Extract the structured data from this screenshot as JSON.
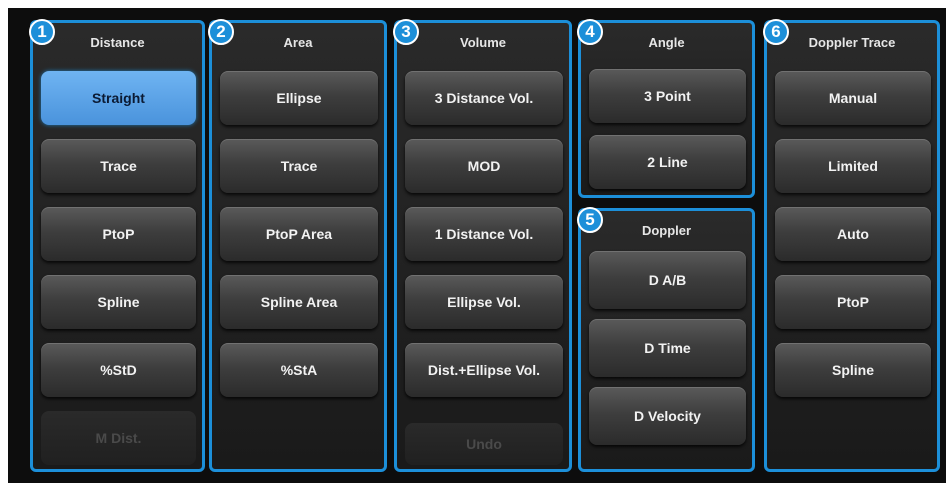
{
  "panels": [
    {
      "number": "1",
      "title": "Distance",
      "buttons": [
        {
          "label": "Straight",
          "state": "selected"
        },
        {
          "label": "Trace",
          "state": "normal"
        },
        {
          "label": "PtoP",
          "state": "normal"
        },
        {
          "label": "Spline",
          "state": "normal"
        },
        {
          "label": "%StD",
          "state": "normal"
        },
        {
          "label": "M Dist.",
          "state": "disabled"
        }
      ]
    },
    {
      "number": "2",
      "title": "Area",
      "buttons": [
        {
          "label": "Ellipse",
          "state": "normal"
        },
        {
          "label": "Trace",
          "state": "normal"
        },
        {
          "label": "PtoP Area",
          "state": "normal"
        },
        {
          "label": "Spline Area",
          "state": "normal"
        },
        {
          "label": "%StA",
          "state": "normal"
        }
      ]
    },
    {
      "number": "3",
      "title": "Volume",
      "buttons": [
        {
          "label": "3 Distance Vol.",
          "state": "normal"
        },
        {
          "label": "MOD",
          "state": "normal"
        },
        {
          "label": "1 Distance Vol.",
          "state": "normal"
        },
        {
          "label": "Ellipse Vol.",
          "state": "normal"
        },
        {
          "label": "Dist.+Ellipse Vol.",
          "state": "normal"
        },
        {
          "label": "Undo",
          "state": "disabled"
        }
      ]
    },
    {
      "number": "4",
      "title": "Angle",
      "buttons": [
        {
          "label": "3 Point",
          "state": "normal"
        },
        {
          "label": "2 Line",
          "state": "normal"
        }
      ]
    },
    {
      "number": "5",
      "title": "Doppler",
      "buttons": [
        {
          "label": "D A/B",
          "state": "normal"
        },
        {
          "label": "D Time",
          "state": "normal"
        },
        {
          "label": "D Velocity",
          "state": "normal"
        }
      ]
    },
    {
      "number": "6",
      "title": "Doppler Trace",
      "buttons": [
        {
          "label": "Manual",
          "state": "normal"
        },
        {
          "label": "Limited",
          "state": "normal"
        },
        {
          "label": "Auto",
          "state": "normal"
        },
        {
          "label": "PtoP",
          "state": "normal"
        },
        {
          "label": "Spline",
          "state": "normal"
        }
      ]
    }
  ],
  "colors": {
    "accent": "#1c8fd9",
    "selected_button": "#4a93dc",
    "background": "#0d0d0d"
  }
}
